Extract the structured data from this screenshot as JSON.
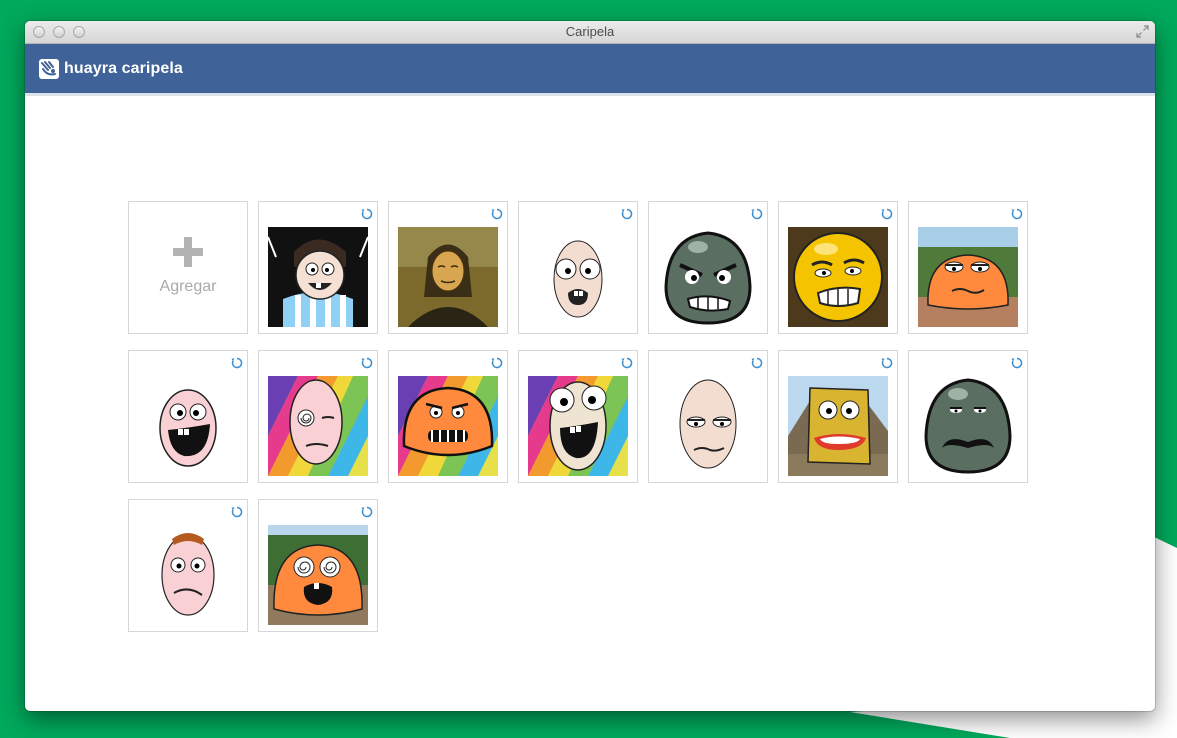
{
  "window": {
    "title": "Caripela"
  },
  "appbar": {
    "brand": "huayra caripela",
    "logo_icon": "huayra-logo-icon"
  },
  "gallery": {
    "add_label": "Agregar",
    "items": [
      {
        "name": "face-1",
        "background": "dark-flag"
      },
      {
        "name": "face-2",
        "background": "mona-lisa"
      },
      {
        "name": "face-3",
        "background": "white"
      },
      {
        "name": "face-4",
        "background": "white"
      },
      {
        "name": "face-5",
        "background": "painting-dark"
      },
      {
        "name": "face-6",
        "background": "landscape"
      },
      {
        "name": "face-7",
        "background": "white"
      },
      {
        "name": "face-8",
        "background": "rainbow"
      },
      {
        "name": "face-9",
        "background": "rainbow"
      },
      {
        "name": "face-10",
        "background": "rainbow"
      },
      {
        "name": "face-11",
        "background": "white"
      },
      {
        "name": "face-12",
        "background": "mountains"
      },
      {
        "name": "face-13",
        "background": "white"
      },
      {
        "name": "face-14",
        "background": "white"
      },
      {
        "name": "face-15",
        "background": "trees"
      }
    ]
  },
  "colors": {
    "desktop": "#00a95c",
    "appbar": "#3f6299",
    "refresh_icon": "#3b8fd1",
    "plus_icon": "#b3b3b3"
  }
}
